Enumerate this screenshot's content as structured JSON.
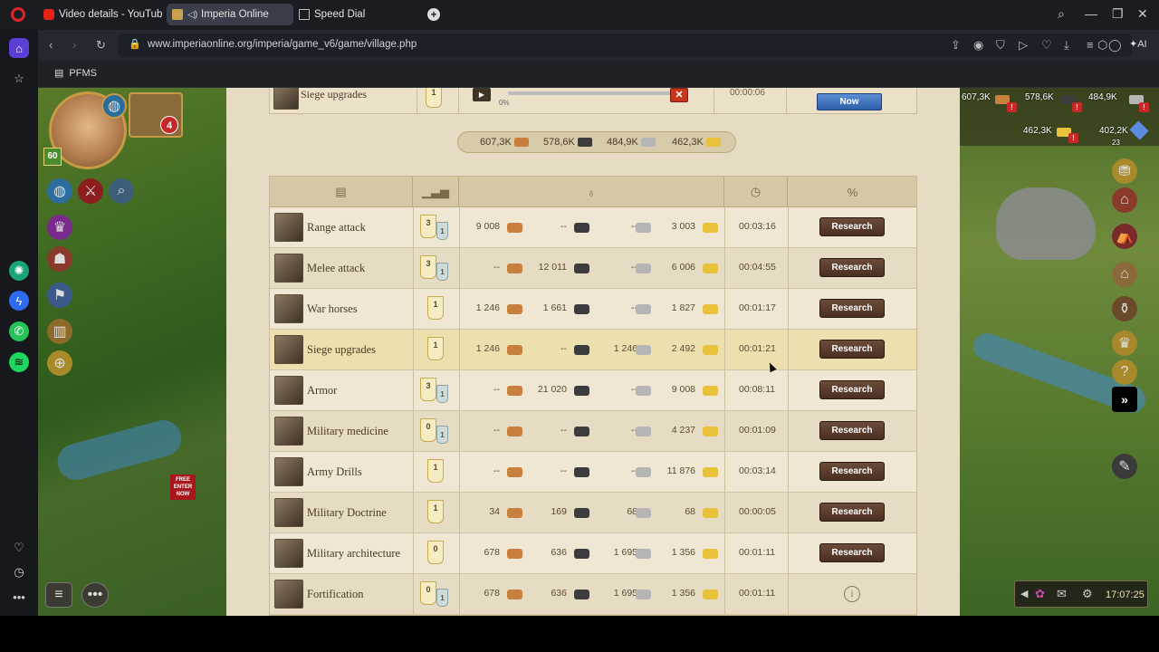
{
  "browser": {
    "tabs": [
      {
        "label": "Video details - YouTube St",
        "active": false
      },
      {
        "label": "Imperia Online",
        "active": true
      },
      {
        "label": "Speed Dial",
        "active": false
      }
    ],
    "url": "www.imperiaonline.org/imperia/game_v6/game/village.php",
    "bookmark": "PFMS",
    "ai_label": "AI"
  },
  "game": {
    "player_level": "60",
    "notification_count": "4",
    "free_badge": "FREE ENTER NOW",
    "queue": {
      "name": "Siege upgrades",
      "level": "1",
      "progress_percent": "0%",
      "time": "00:00:06",
      "now_label": "Now"
    },
    "resources_summary": {
      "wood": "607,3K",
      "iron": "578,6K",
      "stone": "484,9K",
      "gold": "462,3K"
    },
    "top_right_resources": {
      "wood": "607,3K",
      "iron": "578,6K",
      "stone": "484,9K",
      "gold": "462,3K",
      "diamonds": "402,2K",
      "sub_count": "23"
    },
    "research_label": "Research",
    "rows": [
      {
        "name": "Range attack",
        "level": "3",
        "next": "1",
        "wood": "9 008",
        "iron": "--",
        "stone": "--",
        "gold": "3 003",
        "time": "00:03:16",
        "action": "button"
      },
      {
        "name": "Melee attack",
        "level": "3",
        "next": "1",
        "wood": "--",
        "iron": "12 011",
        "stone": "--",
        "gold": "6 006",
        "time": "00:04:55",
        "action": "button"
      },
      {
        "name": "War horses",
        "level": "1",
        "next": "",
        "wood": "1 246",
        "iron": "1 661",
        "stone": "--",
        "gold": "1 827",
        "time": "00:01:17",
        "action": "button"
      },
      {
        "name": "Siege upgrades",
        "level": "1",
        "next": "",
        "wood": "1 246",
        "iron": "--",
        "stone": "1 246",
        "gold": "2 492",
        "time": "00:01:21",
        "action": "button"
      },
      {
        "name": "Armor",
        "level": "3",
        "next": "1",
        "wood": "--",
        "iron": "21 020",
        "stone": "--",
        "gold": "9 008",
        "time": "00:08:11",
        "action": "button"
      },
      {
        "name": "Military medicine",
        "level": "0",
        "next": "1",
        "wood": "--",
        "iron": "--",
        "stone": "--",
        "gold": "4 237",
        "time": "00:01:09",
        "action": "button"
      },
      {
        "name": "Army Drills",
        "level": "1",
        "next": "",
        "wood": "--",
        "iron": "--",
        "stone": "--",
        "gold": "11 876",
        "time": "00:03:14",
        "action": "button"
      },
      {
        "name": "Military Doctrine",
        "level": "1",
        "next": "",
        "wood": "34",
        "iron": "169",
        "stone": "68",
        "gold": "68",
        "time": "00:00:05",
        "action": "button"
      },
      {
        "name": "Military architecture",
        "level": "0",
        "next": "",
        "wood": "678",
        "iron": "636",
        "stone": "1 695",
        "gold": "1 356",
        "time": "00:01:11",
        "action": "button"
      },
      {
        "name": "Fortification",
        "level": "0",
        "next": "1",
        "wood": "678",
        "iron": "636",
        "stone": "1 695",
        "gold": "1 356",
        "time": "00:01:11",
        "action": "info"
      }
    ],
    "clock": "17:07:25"
  }
}
